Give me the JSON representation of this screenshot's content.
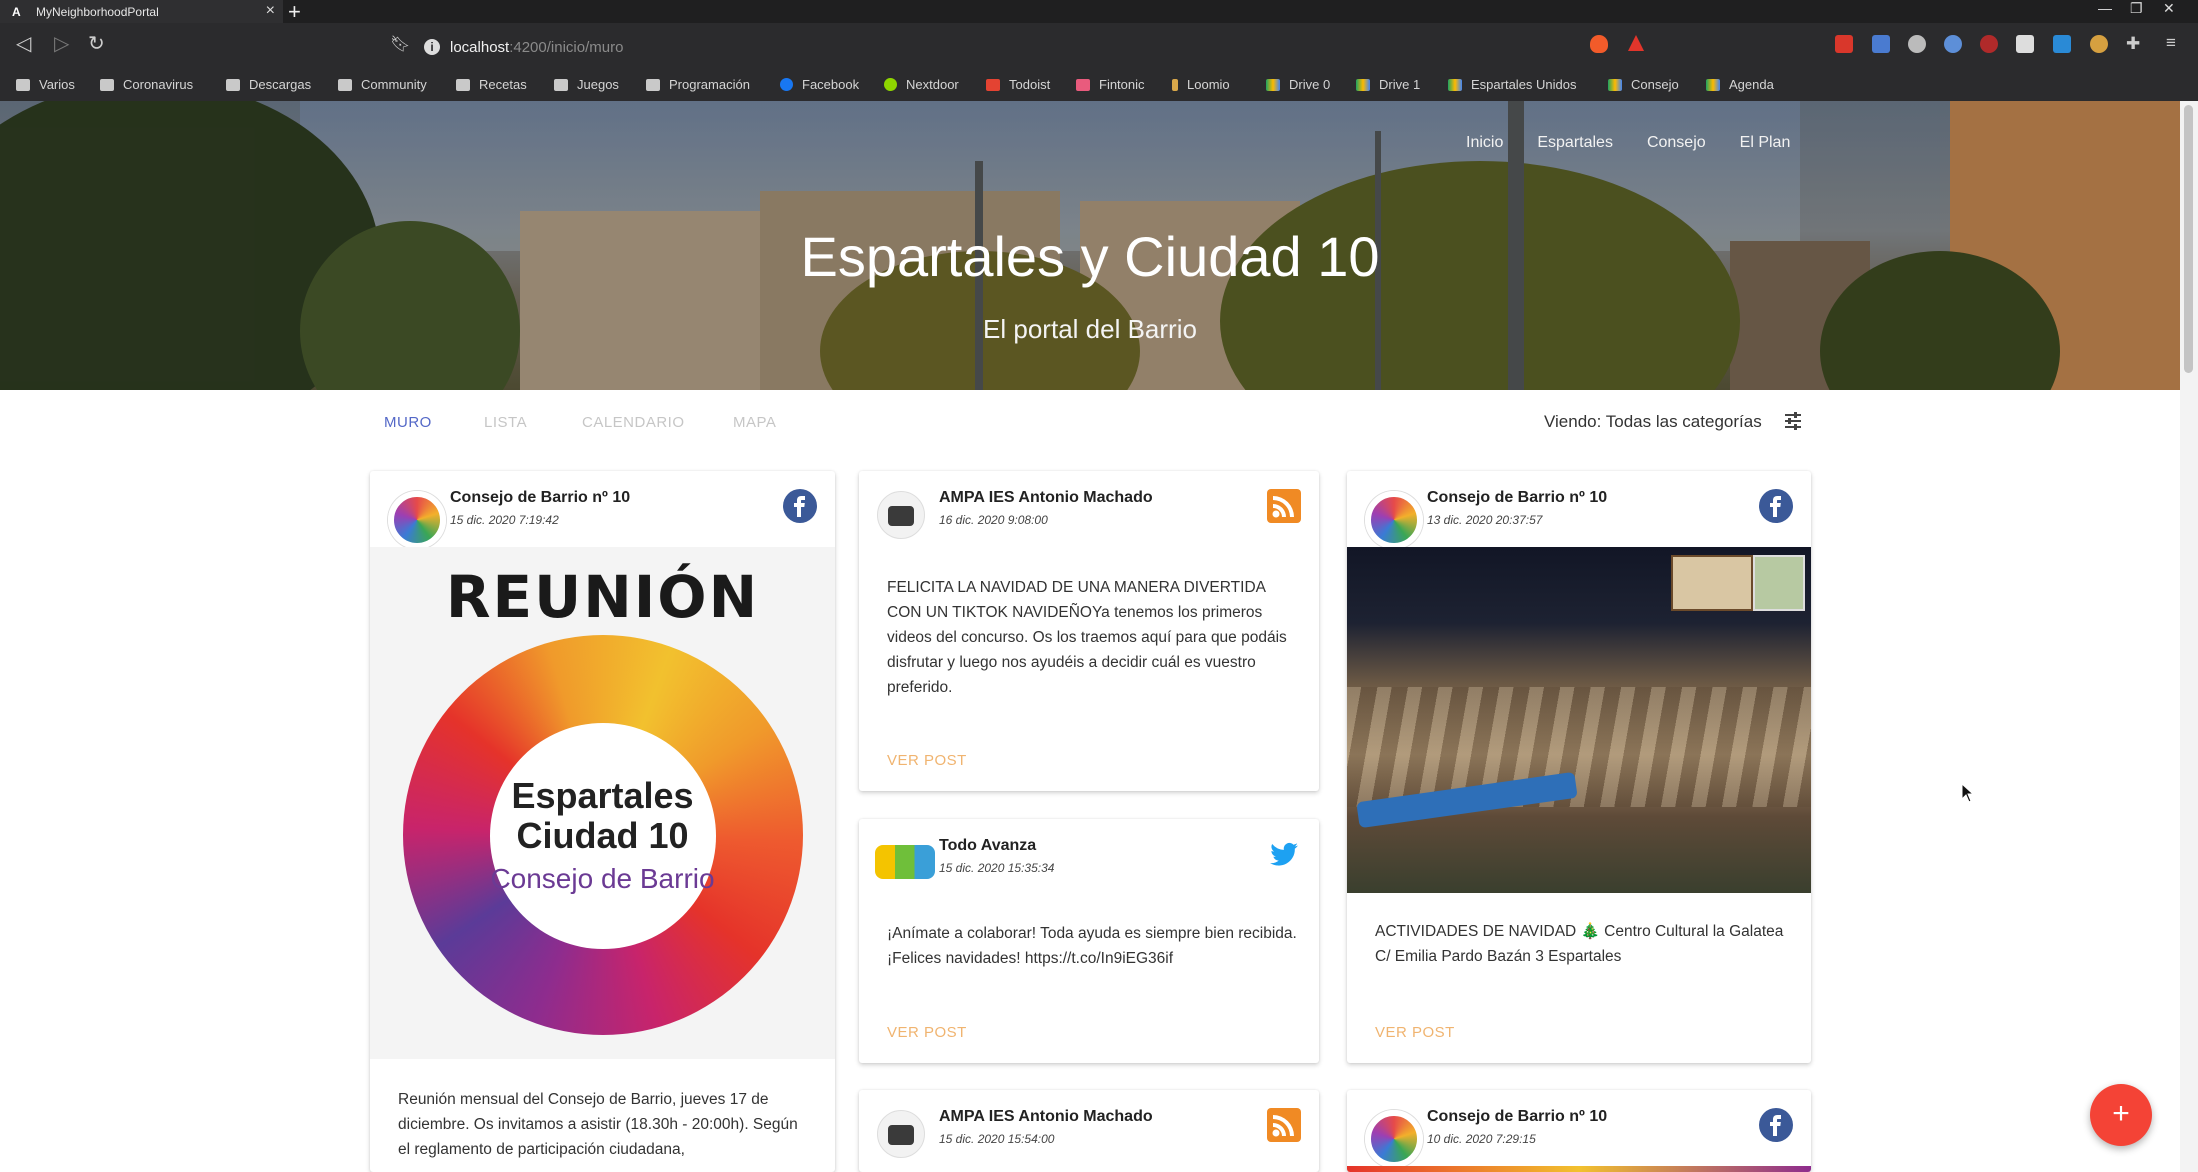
{
  "browser": {
    "tab_title": "MyNeighborhoodPortal",
    "tab_favicon": "A",
    "url_host": "localhost",
    "url_path": ":4200/inicio/muro",
    "bookmarks": [
      "Varios",
      "Coronavirus",
      "Descargas",
      "Community",
      "Recetas",
      "Juegos",
      "Programación",
      "Facebook",
      "Nextdoor",
      "Todoist",
      "Fintonic",
      "Loomio",
      "Drive 0",
      "Drive 1",
      "Espartales Unidos",
      "Consejo",
      "Agenda"
    ]
  },
  "hero": {
    "nav": [
      "Inicio",
      "Espartales",
      "Consejo",
      "El Plan"
    ],
    "title": "Espartales y Ciudad 10",
    "subtitle": "El portal del Barrio"
  },
  "views": {
    "tabs": [
      "MURO",
      "LISTA",
      "CALENDARIO",
      "MAPA"
    ],
    "active": "MURO",
    "viewing_label": "Viendo: Todas las categorías"
  },
  "posts": [
    {
      "author": "Consejo de Barrio nº 10",
      "date": "15 dic. 2020 7:19:42",
      "source": "facebook",
      "image_heading": "REUNIÓN",
      "image_line1": "Espartales",
      "image_line2": "Ciudad 10",
      "image_line3": "Consejo de Barrio",
      "text": "Reunión mensual del Consejo de Barrio, jueves 17 de diciembre. Os invitamos a asistir (18.30h - 20:00h). Según el reglamento de participación ciudadana,"
    },
    {
      "author": "AMPA IES Antonio Machado",
      "date": "16 dic. 2020 9:08:00",
      "source": "rss",
      "text": "FELICITA LA NAVIDAD DE UNA MANERA DIVERTIDA CON UN TIKTOK NAVIDEÑOYa tenemos los primeros videos del concurso. Os los traemos aquí para que podáis disfrutar y luego nos ayudéis a decidir cuál es vuestro preferido.",
      "cta": "VER POST"
    },
    {
      "author": "Todo Avanza",
      "date": "15 dic. 2020 15:35:34",
      "source": "twitter",
      "text": "¡Anímate a colaborar! Toda ayuda es siempre bien recibida. ¡Felices navidades! https://t.co/In9iEG36if",
      "cta": "VER POST"
    },
    {
      "author": "AMPA IES Antonio Machado",
      "date": "15 dic. 2020 15:54:00",
      "source": "rss"
    },
    {
      "author": "Consejo de Barrio nº 10",
      "date": "13 dic. 2020 20:37:57",
      "source": "facebook",
      "text": "ACTIVIDADES DE NAVIDAD 🎄 Centro Cultural la Galatea C/ Emilia Pardo Bazán 3 Espartales",
      "cta": "VER POST"
    },
    {
      "author": "Consejo de Barrio nº 10",
      "date": "10 dic. 2020 7:29:15",
      "source": "facebook"
    }
  ],
  "colors": {
    "accent": "#5468c7",
    "cta": "#f0b470",
    "fab": "#f44336",
    "facebook": "#3b5998",
    "rss": "#f08a24",
    "twitter": "#1da1f2"
  },
  "fab_icon": "+"
}
